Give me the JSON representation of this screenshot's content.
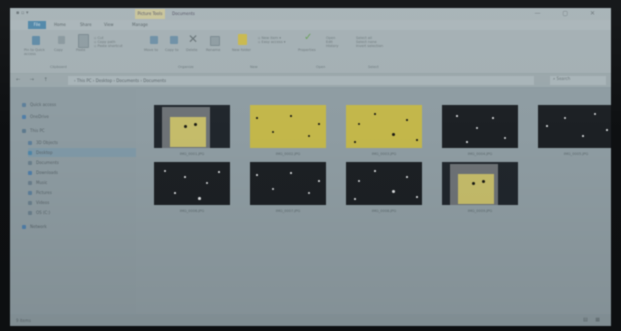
{
  "titlebar": {
    "context_tab": "Picture Tools",
    "title": "Documents",
    "controls": "— ▢ ✕"
  },
  "ribbon_tabs": [
    "File",
    "Home",
    "Share",
    "View",
    "Manage"
  ],
  "ribbon": {
    "groups": [
      "Clipboard",
      "Organize",
      "New",
      "Open",
      "Select"
    ],
    "buttons": [
      "Pin to Quick access",
      "Copy",
      "Paste",
      "Move to",
      "Copy to",
      "Delete",
      "Rename",
      "New folder",
      "Properties",
      "Open",
      "Edit",
      "History",
      "Select all",
      "Select none",
      "Invert selection"
    ]
  },
  "address": {
    "path": "›  This PC  ›  Desktop  ›  Documents  ›  Documents",
    "nav_buttons": "←  →  ↑",
    "search_placeholder": "Search"
  },
  "nav_pane": {
    "items": [
      {
        "label": "Quick access",
        "color": "#5d7f9a"
      },
      {
        "label": "OneDrive",
        "color": "#4f7ea8"
      },
      {
        "label": "This PC",
        "color": "#5e7a8e"
      },
      {
        "label": "3D Objects",
        "color": "#5d7f9a"
      },
      {
        "label": "Desktop",
        "color": "#4f86a8"
      },
      {
        "label": "Documents",
        "color": "#6a7f8c"
      },
      {
        "label": "Downloads",
        "color": "#4f7ea8"
      },
      {
        "label": "Music",
        "color": "#6a7f8c"
      },
      {
        "label": "Pictures",
        "color": "#5d7f9a"
      },
      {
        "label": "Videos",
        "color": "#6a7f8c"
      },
      {
        "label": "OS (C:)",
        "color": "#6a7f8c"
      },
      {
        "label": "Network",
        "color": "#4f7ea8"
      }
    ],
    "selected_index": 4
  },
  "files": [
    {
      "name": "IMG_0001.JPG",
      "kind": "photo"
    },
    {
      "name": "IMG_0002.JPG",
      "kind": "yellow"
    },
    {
      "name": "IMG_0003.JPG",
      "kind": "yellow"
    },
    {
      "name": "IMG_0004.JPG",
      "kind": "dark"
    },
    {
      "name": "IMG_0005.JPG",
      "kind": "dark"
    },
    {
      "name": "IMG_0006.JPG",
      "kind": "dark"
    },
    {
      "name": "IMG_0007.JPG",
      "kind": "dark"
    },
    {
      "name": "IMG_0008.JPG",
      "kind": "dark"
    },
    {
      "name": "IMG_0009.JPG",
      "kind": "photo"
    }
  ],
  "statusbar": {
    "items_text": "9 items",
    "view_buttons": "▤ ▦"
  }
}
